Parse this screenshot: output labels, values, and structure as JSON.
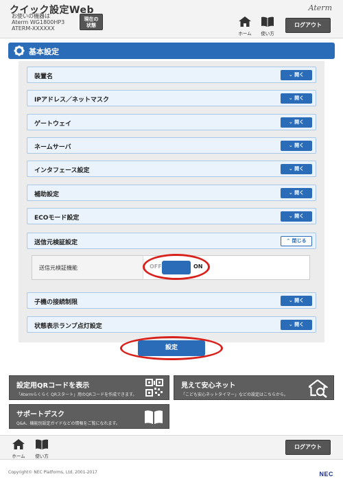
{
  "header": {
    "title": "クイック設定Web",
    "device_line1": "お使いの機器は",
    "device_model": "Aterm WG1800HP3",
    "device_ssid": "ATERM-XXXXXX",
    "status_button_line1": "現在の",
    "status_button_line2": "状態",
    "brand": "Aterm",
    "home_label": "ホーム",
    "help_label": "使い方",
    "logout_label": "ログアウト"
  },
  "section": {
    "title": "基本設定"
  },
  "rows": [
    {
      "label": "装置名",
      "button": "開く"
    },
    {
      "label": "IPアドレス／ネットマスク",
      "button": "開く"
    },
    {
      "label": "ゲートウェイ",
      "button": "開く"
    },
    {
      "label": "ネームサーバ",
      "button": "開く"
    },
    {
      "label": "インタフェース設定",
      "button": "開く"
    },
    {
      "label": "補助設定",
      "button": "開く"
    },
    {
      "label": "ECOモード設定",
      "button": "開く"
    },
    {
      "label": "送信元検証設定",
      "button": "閉じる"
    },
    {
      "label": "子機の接続制限",
      "button": "開く"
    },
    {
      "label": "状態表示ランプ点灯設定",
      "button": "開く"
    }
  ],
  "source_verify": {
    "field_label": "送信元検証機能",
    "off_label": "OFF",
    "on_label": "ON",
    "state": "ON"
  },
  "apply_button": "設定",
  "cards": {
    "qr": {
      "title": "設定用QRコードを表示",
      "desc": "「Atermらくらく QRスタート」用のQRコードを作成できます。",
      "icon": "qr-code-icon"
    },
    "safe_net": {
      "title": "見えて安心ネット",
      "desc": "「こども安心ネットタイマー」などの設定はこちらから。",
      "icon": "house-search-icon"
    },
    "support": {
      "title": "サポートデスク",
      "desc": "Q&A、機能別設定ガイドなどの情報をご覧になれます。",
      "icon": "book-icon"
    }
  },
  "footer": {
    "home_label": "ホーム",
    "help_label": "使い方",
    "logout_label": "ログアウト",
    "copyright": "Copyright© NEC Platforms, Ltd. 2001-2017",
    "logo": "NEC"
  },
  "colors": {
    "accent": "#2b6cb8",
    "highlight_ring": "#d9211c",
    "card_bg": "#5e5e5e"
  }
}
